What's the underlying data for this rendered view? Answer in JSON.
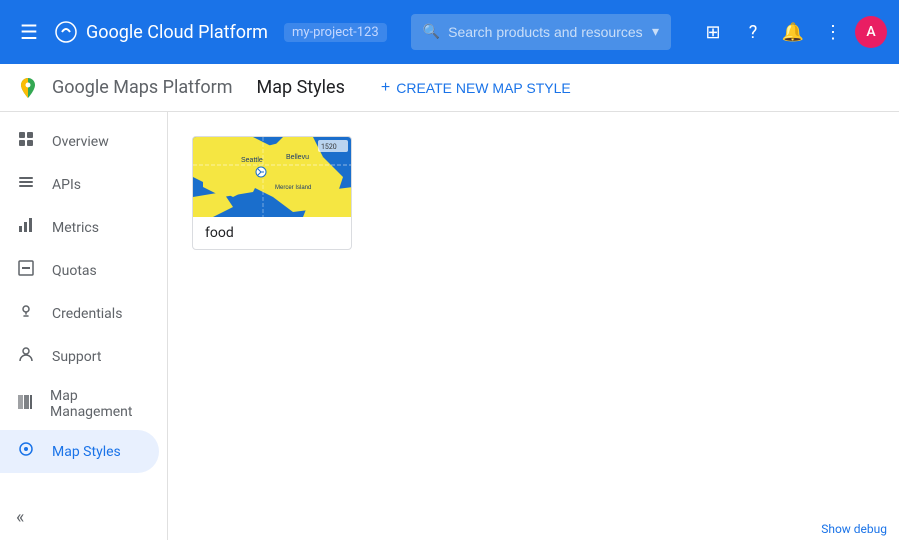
{
  "topbar": {
    "menu_icon": "☰",
    "title": "Google Cloud Platform",
    "account": "my-project-123",
    "search_placeholder": "Search products and resources"
  },
  "subheader": {
    "app_title": "Google Maps Platform",
    "page_title": "Map Styles",
    "create_button": "CREATE NEW MAP STYLE"
  },
  "sidebar": {
    "items": [
      {
        "id": "overview",
        "label": "Overview",
        "icon": "⊙"
      },
      {
        "id": "apis",
        "label": "APIs",
        "icon": "≡"
      },
      {
        "id": "metrics",
        "label": "Metrics",
        "icon": "↑"
      },
      {
        "id": "quotas",
        "label": "Quotas",
        "icon": "▭"
      },
      {
        "id": "credentials",
        "label": "Credentials",
        "icon": "⚿"
      },
      {
        "id": "support",
        "label": "Support",
        "icon": "👤"
      },
      {
        "id": "map-management",
        "label": "Map Management",
        "icon": "▦"
      },
      {
        "id": "map-styles",
        "label": "Map Styles",
        "icon": "◎"
      }
    ],
    "collapse_icon": "«"
  },
  "map_styles": [
    {
      "id": "food",
      "label": "food"
    }
  ],
  "debug_bar": {
    "label": "Show debug"
  },
  "colors": {
    "active_blue": "#1a73e8",
    "active_bg": "#e8f0fe"
  }
}
